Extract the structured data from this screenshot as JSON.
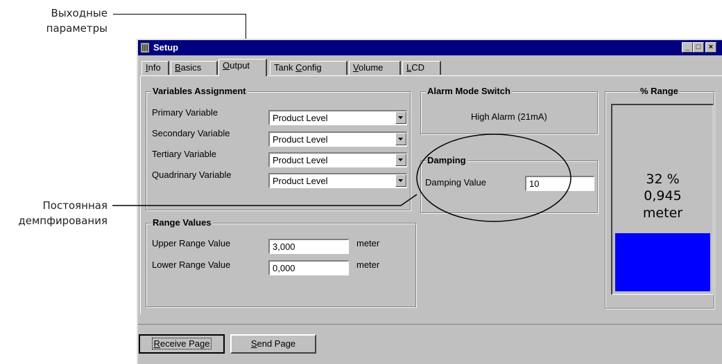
{
  "annotations": {
    "output_params_line1": "Выходные",
    "output_params_line2": "параметры",
    "damping_const_line1": "Постоянная",
    "damping_const_line2": "демпфирования"
  },
  "window": {
    "title": "Setup",
    "minimize": "_",
    "maximize": "□",
    "close": "×"
  },
  "tabs": [
    {
      "label_pre": "",
      "label_u": "I",
      "label_post": "nfo"
    },
    {
      "label_pre": "",
      "label_u": "B",
      "label_post": "asics"
    },
    {
      "label_pre": "",
      "label_u": "O",
      "label_post": "utput"
    },
    {
      "label_pre": "Tank ",
      "label_u": "C",
      "label_post": "onfig"
    },
    {
      "label_pre": "",
      "label_u": "V",
      "label_post": "olume"
    },
    {
      "label_pre": "",
      "label_u": "L",
      "label_post": "CD"
    }
  ],
  "variables_assignment": {
    "title": "Variables Assignment",
    "rows": [
      {
        "label": "Primary Variable",
        "value": "Product Level"
      },
      {
        "label": "Secondary Variable",
        "value": "Product Level"
      },
      {
        "label": "Tertiary Variable",
        "value": "Product Level"
      },
      {
        "label": "Quadrinary Variable",
        "value": "Product Level"
      }
    ]
  },
  "alarm_mode": {
    "title": "Alarm Mode Switch",
    "value": "High Alarm (21mA)"
  },
  "damping": {
    "title": "Damping",
    "label": "Damping Value",
    "value": "10"
  },
  "range_values": {
    "title": "Range Values",
    "upper_label": "Upper Range Value",
    "upper_value": "3,000",
    "upper_unit": "meter",
    "lower_label": "Lower Range Value",
    "lower_value": "0,000",
    "lower_unit": "meter"
  },
  "percent_range": {
    "title": "% Range",
    "percent": "32 %",
    "value": "0,945",
    "unit": "meter",
    "fill_percent": 32,
    "fill_color": "#0000ff"
  },
  "buttons": {
    "receive_pre": "",
    "receive_u": "R",
    "receive_post": "eceive Page",
    "send_pre": "",
    "send_u": "S",
    "send_post": "end Page"
  },
  "colors": {
    "title_bar": "#000080",
    "face": "#c0c0c0"
  }
}
